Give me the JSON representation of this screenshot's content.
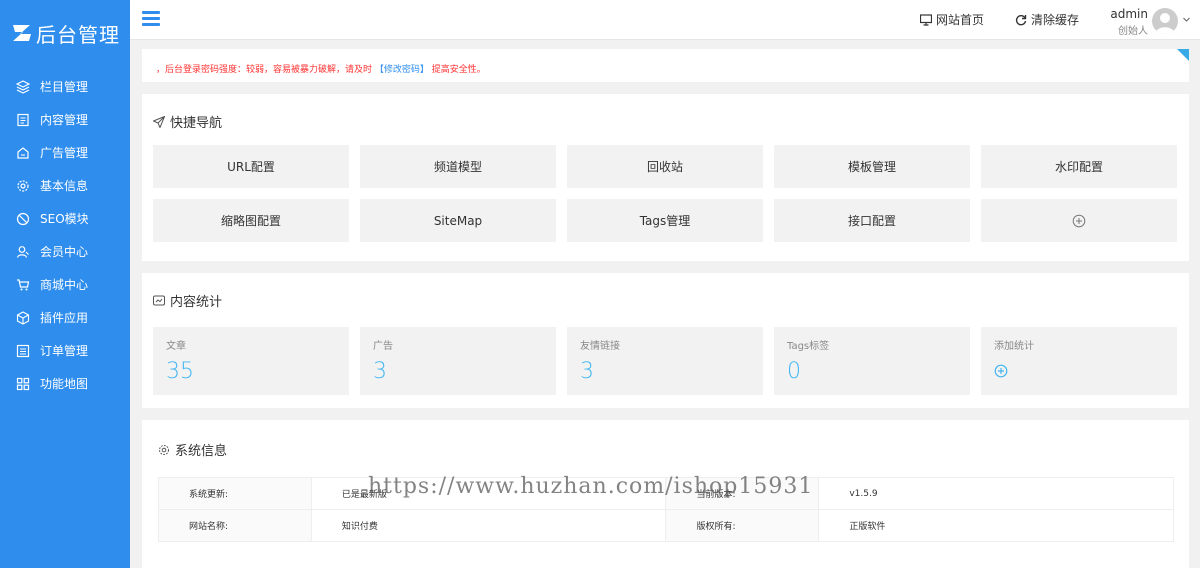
{
  "app": {
    "title": "后台管理",
    "brand_color": "#2e8ded"
  },
  "sidebar": {
    "items": [
      {
        "label": "栏目管理",
        "icon": "layers-icon"
      },
      {
        "label": "内容管理",
        "icon": "document-icon"
      },
      {
        "label": "广告管理",
        "icon": "ad-icon"
      },
      {
        "label": "基本信息",
        "icon": "gear-icon"
      },
      {
        "label": "SEO模块",
        "icon": "seo-icon"
      },
      {
        "label": "会员中心",
        "icon": "user-icon"
      },
      {
        "label": "商城中心",
        "icon": "cart-icon"
      },
      {
        "label": "插件应用",
        "icon": "plugin-icon"
      },
      {
        "label": "订单管理",
        "icon": "list-icon"
      },
      {
        "label": "功能地图",
        "icon": "grid-icon"
      }
    ]
  },
  "header": {
    "site_home": "网站首页",
    "clear_cache": "清除缓存",
    "user_name": "admin",
    "user_role": "创始人"
  },
  "alert": {
    "prefix": "，后台登录密码强度：较弱，容易被暴力破解，请及时",
    "link": "【修改密码】",
    "suffix": "提高安全性。"
  },
  "quick_nav": {
    "title": "快捷导航",
    "items": [
      "URL配置",
      "频道模型",
      "回收站",
      "模板管理",
      "水印配置",
      "缩略图配置",
      "SiteMap",
      "Tags管理",
      "接口配置"
    ]
  },
  "stats": {
    "title": "内容统计",
    "items": [
      {
        "label": "文章",
        "value": "35"
      },
      {
        "label": "广告",
        "value": "3"
      },
      {
        "label": "友情链接",
        "value": "3"
      },
      {
        "label": "Tags标签",
        "value": "0"
      }
    ],
    "add_label": "添加统计"
  },
  "sysinfo": {
    "title": "系统信息",
    "rows": [
      {
        "k1": "系统更新:",
        "v1": "已是最新版",
        "k2": "当前版本:",
        "v2": "v1.5.9"
      },
      {
        "k1": "网站名称:",
        "v1": "知识付费",
        "k2": "版权所有:",
        "v2": "正版软件"
      }
    ]
  },
  "watermark": "https://www.huzhan.com/ishop15931"
}
